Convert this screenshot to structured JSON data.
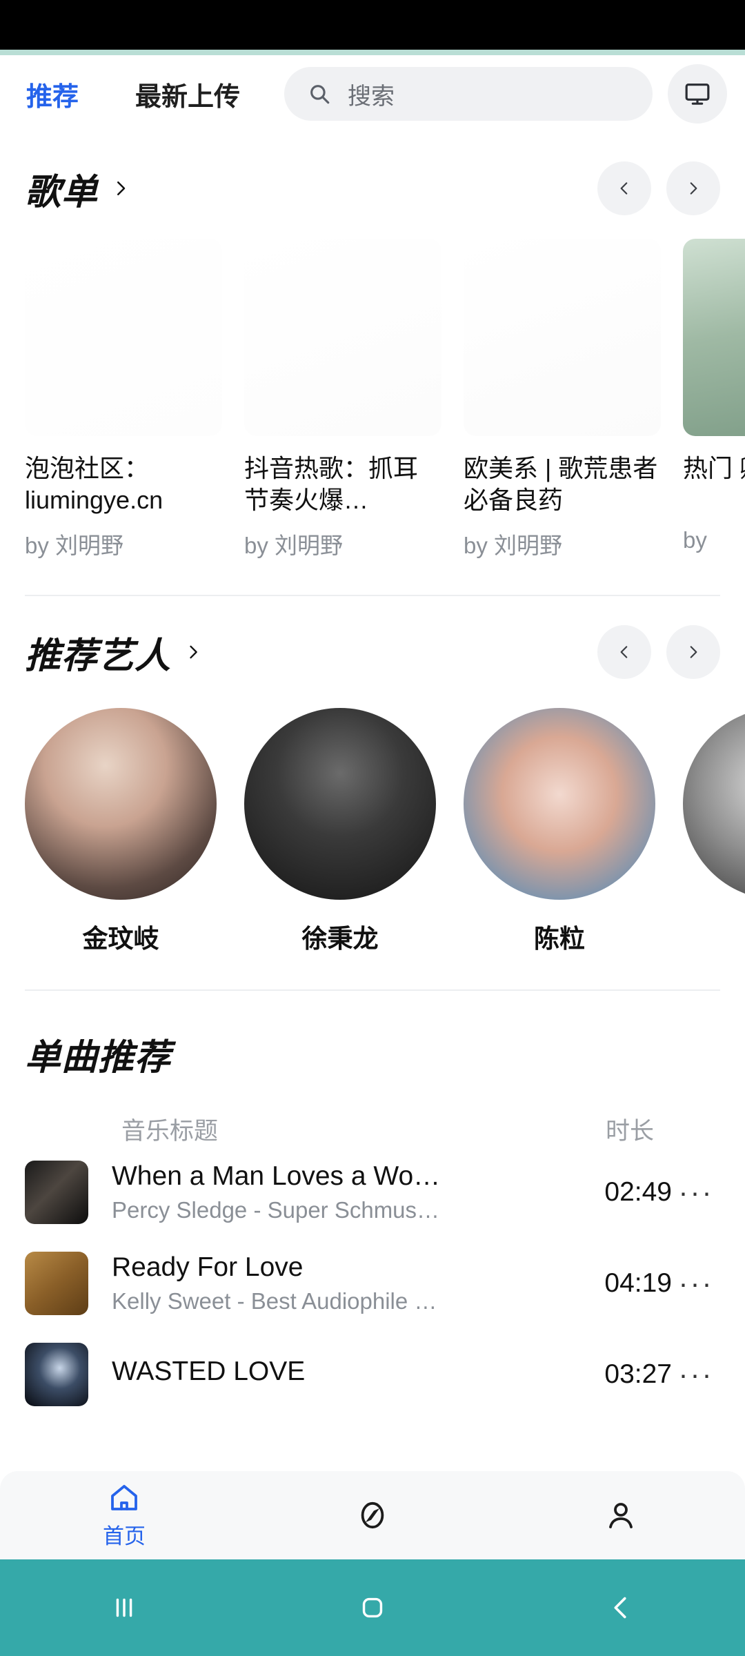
{
  "header": {
    "tabs": [
      {
        "label": "推荐",
        "active": true
      },
      {
        "label": "最新上传",
        "active": false
      }
    ],
    "search": {
      "placeholder": "搜索",
      "value": ""
    },
    "cast_icon": "monitor-icon"
  },
  "playlist_section": {
    "title": "歌单",
    "chevron": "chevron-right-icon",
    "prev_icon": "chevron-left-icon",
    "next_icon": "chevron-right-icon",
    "items": [
      {
        "title": "泡泡社区：liumingye.cn",
        "by": "by 刘明野"
      },
      {
        "title": "抖音热歌：抓耳节奏火爆…",
        "by": "by 刘明野"
      },
      {
        "title": "欧美系 | 歌荒患者必备良药",
        "by": "by 刘明野"
      },
      {
        "title": "热门\n卿子",
        "by": "by"
      }
    ]
  },
  "artist_section": {
    "title": "推荐艺人",
    "chevron": "chevron-right-icon",
    "prev_icon": "chevron-left-icon",
    "next_icon": "chevron-right-icon",
    "items": [
      {
        "name": "金玟岐"
      },
      {
        "name": "徐秉龙"
      },
      {
        "name": "陈粒"
      },
      {
        "name": ""
      }
    ]
  },
  "songs_section": {
    "title": "单曲推荐",
    "columns": {
      "title": "音乐标题",
      "duration": "时长"
    },
    "rows": [
      {
        "name": "When a Man Loves a Wo…",
        "sub": "Percy Sledge - Super Schmus…",
        "duration": "02:49",
        "more": "···"
      },
      {
        "name": "Ready For Love",
        "sub": "Kelly Sweet - Best Audiophile …",
        "duration": "04:19",
        "more": "···"
      },
      {
        "name": "WASTED LOVE",
        "sub": "",
        "duration": "03:27",
        "more": "···"
      }
    ]
  },
  "bottom_nav": {
    "items": [
      {
        "label": "首页",
        "icon": "home-icon",
        "active": true
      },
      {
        "label": "",
        "icon": "compass-icon",
        "active": false
      },
      {
        "label": "",
        "icon": "person-icon",
        "active": false
      }
    ]
  },
  "android_nav": {
    "recents_icon": "recents-icon",
    "home_icon": "home-square-icon",
    "back_icon": "back-chevron-icon"
  },
  "colors": {
    "accent": "#2563eb",
    "mint_line": "#b9ded5",
    "android_nav": "#35a9a9",
    "muted_text": "#8a8f96"
  }
}
